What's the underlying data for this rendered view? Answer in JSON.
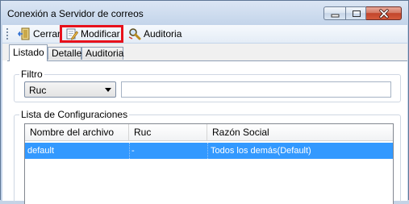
{
  "window": {
    "title": "Conexión a Servidor de correos"
  },
  "toolbar": {
    "cerrar_label": "Cerrar",
    "modificar_label": "Modificar",
    "auditoria_label": "Auditoria"
  },
  "tabs": [
    {
      "label": "Listado",
      "active": true
    },
    {
      "label": "Detalle",
      "active": false
    },
    {
      "label": "Auditoria",
      "active": false
    }
  ],
  "filtro": {
    "title": "Filtro",
    "field_selected": "Ruc",
    "value": ""
  },
  "lista": {
    "title": "Lista de Configuraciones",
    "columns": [
      "Nombre del archivo",
      "Ruc",
      "Razón Social"
    ],
    "rows": [
      {
        "nombre": "default",
        "ruc": "-",
        "razon_social": "Todos los demás(Default)",
        "selected": true
      }
    ]
  },
  "colors": {
    "selection": "#3399ff",
    "highlight_border": "#e8111b",
    "close_button": "#c2452c"
  }
}
